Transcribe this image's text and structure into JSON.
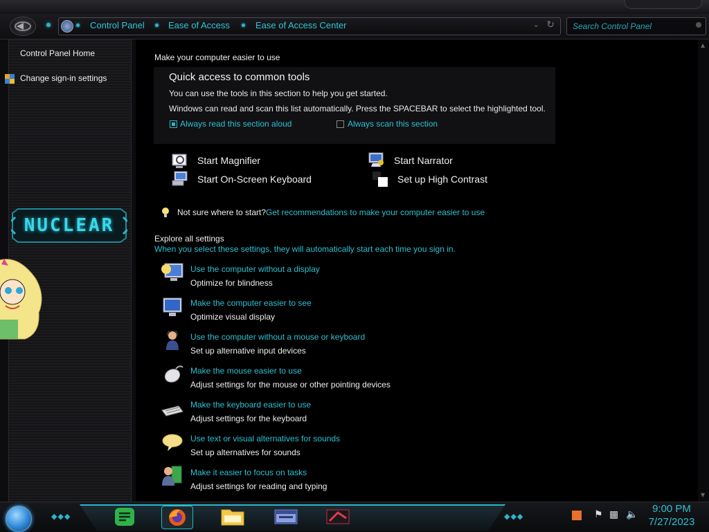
{
  "breadcrumb": [
    "Control Panel",
    "Ease of Access",
    "Ease of Access Center"
  ],
  "search": {
    "placeholder": "Search Control Panel"
  },
  "sidebar": {
    "items": [
      {
        "label": "Control Panel Home"
      },
      {
        "label": "Change sign-in settings"
      }
    ],
    "logo_text": "NUCLEAR"
  },
  "main": {
    "heading": "Make your computer easier to use",
    "quick_access": {
      "title": "Quick access to common tools",
      "line1": "You can use the tools in this section to help you get started.",
      "line2": "Windows can read and scan this list automatically.  Press the SPACEBAR to select the highlighted tool.",
      "read_aloud": {
        "label": "Always read this section aloud",
        "checked": true
      },
      "scan": {
        "label": "Always scan this section",
        "checked": false
      }
    },
    "tools": [
      {
        "label": "Start Magnifier",
        "icon": "magnifier-icon"
      },
      {
        "label": "Start Narrator",
        "icon": "narrator-icon"
      },
      {
        "label": "Start On-Screen Keyboard",
        "icon": "keyboard-icon"
      },
      {
        "label": "Set up High Contrast",
        "icon": "contrast-icon"
      }
    ],
    "hint": {
      "prefix": "Not sure where to start?",
      "link": "Get recommendations to make your computer easier to use"
    },
    "explore": {
      "title": "Explore all settings",
      "subtitle": "When you select these settings, they will automatically start each time you sign in."
    },
    "categories": [
      {
        "link": "Use the computer without a display",
        "desc": "Optimize for blindness",
        "icon": "monitor-blind-icon"
      },
      {
        "link": "Make the computer easier to see",
        "desc": "Optimize visual display",
        "icon": "monitor-icon"
      },
      {
        "link": "Use the computer without a mouse or keyboard",
        "desc": "Set up alternative input devices",
        "icon": "person-headset-icon"
      },
      {
        "link": "Make the mouse easier to use",
        "desc": "Adjust settings for the mouse or other pointing devices",
        "icon": "mouse-icon"
      },
      {
        "link": "Make the keyboard easier to use",
        "desc": "Adjust settings for the keyboard",
        "icon": "keyboard-icon"
      },
      {
        "link": "Use text or visual alternatives for sounds",
        "desc": "Set up alternatives for sounds",
        "icon": "speech-bubble-icon"
      },
      {
        "link": "Make it easier to focus on tasks",
        "desc": "Adjust settings for reading and typing",
        "icon": "person-task-icon"
      }
    ]
  },
  "taskbar": {
    "apps": [
      "notes-app-icon",
      "firefox-icon",
      "file-explorer-icon",
      "window-app-icon",
      "media-app-icon"
    ],
    "time": "9:00 PM",
    "date": "7/27/2023"
  },
  "colors": {
    "accent": "#2ec0d2",
    "background": "#000000",
    "text": "#e6e6e6"
  }
}
